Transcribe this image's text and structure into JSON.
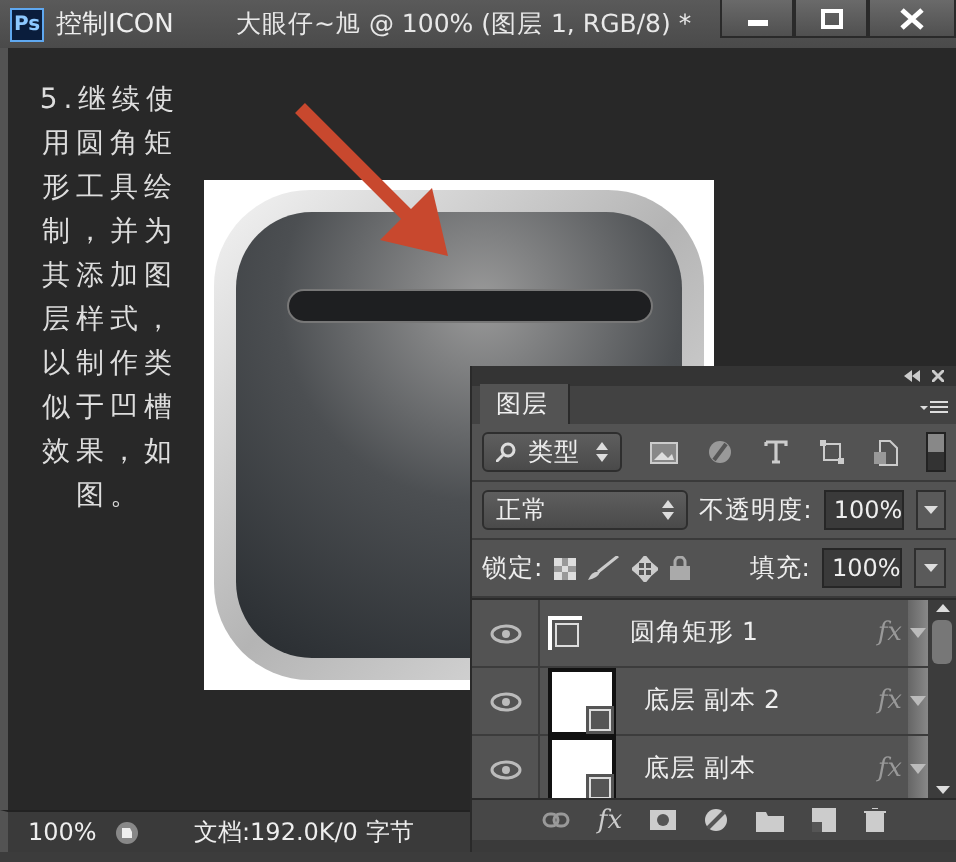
{
  "window": {
    "app_icon": "Ps",
    "title": "控制ICON",
    "document": "大眼仔~旭 @ 100% (图层 1, RGB/8) *"
  },
  "canvas": {
    "instruction": "5.继续使用圆角矩形工具绘制，并为其添加图层样式，以制作类似于凹槽效果，如图。"
  },
  "layers_panel": {
    "tab": "图层",
    "filter": "类型",
    "blend_mode": "正常",
    "opacity_label": "不透明度:",
    "opacity": "100%",
    "lock_label": "锁定:",
    "fill_label": "填充:",
    "fill": "100%",
    "layers": [
      {
        "name": "圆角矩形 1",
        "kind": "shape",
        "visible": true,
        "effects": "fx"
      },
      {
        "name": "底层 副本 2",
        "kind": "filled-shape",
        "visible": true,
        "effects": "fx"
      },
      {
        "name": "底层 副本",
        "kind": "filled-shape",
        "visible": true,
        "effects": "fx"
      }
    ],
    "filter_on": true,
    "footer_fx": "fx"
  },
  "status_bar": {
    "zoom": "100%",
    "doc_info": "文档:192.0K/0 字节"
  }
}
